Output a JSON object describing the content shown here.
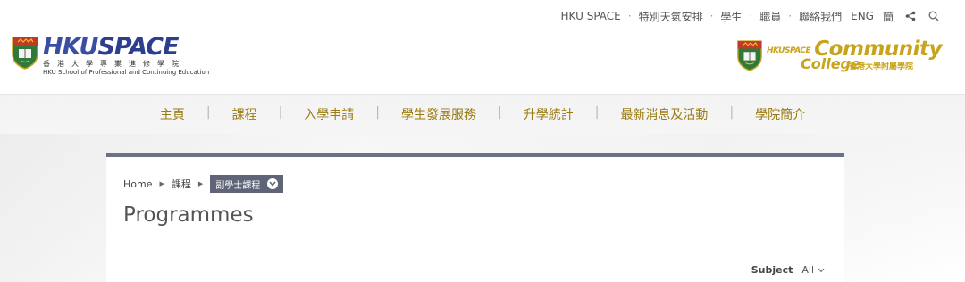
{
  "topbar": {
    "links": [
      "HKU SPACE",
      "特別天氣安排",
      "學生",
      "職員",
      "聯絡我們"
    ],
    "eng": "ENG",
    "simplified": "簡"
  },
  "logo_left": {
    "wordmark_a": "HKU",
    "wordmark_b": "SPACE",
    "chinese": "香港大學專業進修學院",
    "english": "HKU School of Professional and Continuing Education"
  },
  "logo_right": {
    "hku_space": "HKUSPACE",
    "community": "Community",
    "college": "College",
    "chinese": "香港大學附屬學院"
  },
  "mainnav": {
    "items": [
      "主頁",
      "課程",
      "入學申請",
      "學生發展服務",
      "升學統計",
      "最新消息及活動",
      "學院簡介"
    ]
  },
  "breadcrumb": {
    "home": "Home",
    "level1": "課程",
    "current": "副學士課程"
  },
  "page": {
    "title": "Programmes"
  },
  "filter": {
    "label": "Subject",
    "value": "All"
  },
  "colors": {
    "nav_gold": "#9a7b12",
    "cc_gold": "#c8a41c",
    "hku_blue": "#2d3e8f",
    "panel_bar": "#6c7187"
  }
}
